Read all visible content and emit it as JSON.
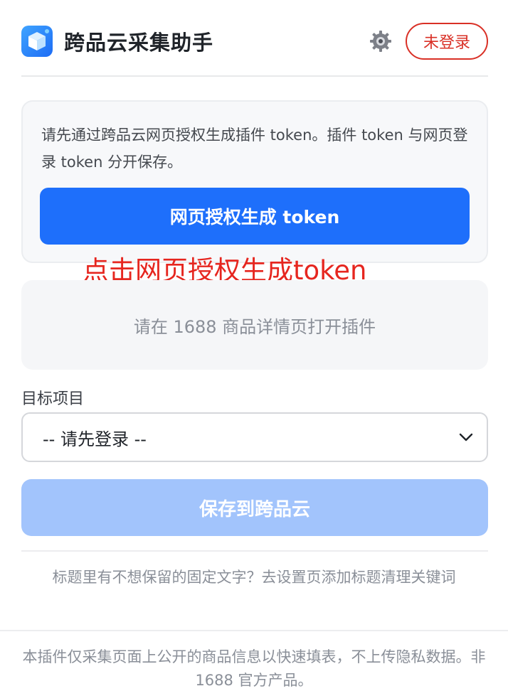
{
  "header": {
    "app_title": "跨品云采集助手",
    "logo_icon": "cube-logo-icon",
    "settings_icon": "gear-icon",
    "login_label": "未登录"
  },
  "token_card": {
    "description": "请先通过跨品云网页授权生成插件 token。插件 token 与网页登录 token 分开保存。",
    "auth_button_label": "网页授权生成 token"
  },
  "annotation": {
    "text": "点击网页授权生成token"
  },
  "notice": {
    "text": "请在 1688 商品详情页打开插件"
  },
  "target_project": {
    "label": "目标项目",
    "selected": "-- 请先登录 --",
    "icon": "chevron-down-icon"
  },
  "actions": {
    "save_label": "保存到跨品云"
  },
  "hint": {
    "text": "标题里有不想保留的固定文字？去设置页添加标题清理关键词"
  },
  "footer": {
    "text": "本插件仅采集页面上公开的商品信息以快速填表，不上传隐私数据。非 1688 官方产品。"
  },
  "colors": {
    "primary": "#1e6ffb",
    "primary_disabled": "#a2c4fc",
    "danger": "#d93026",
    "annotation": "#e6261f"
  }
}
